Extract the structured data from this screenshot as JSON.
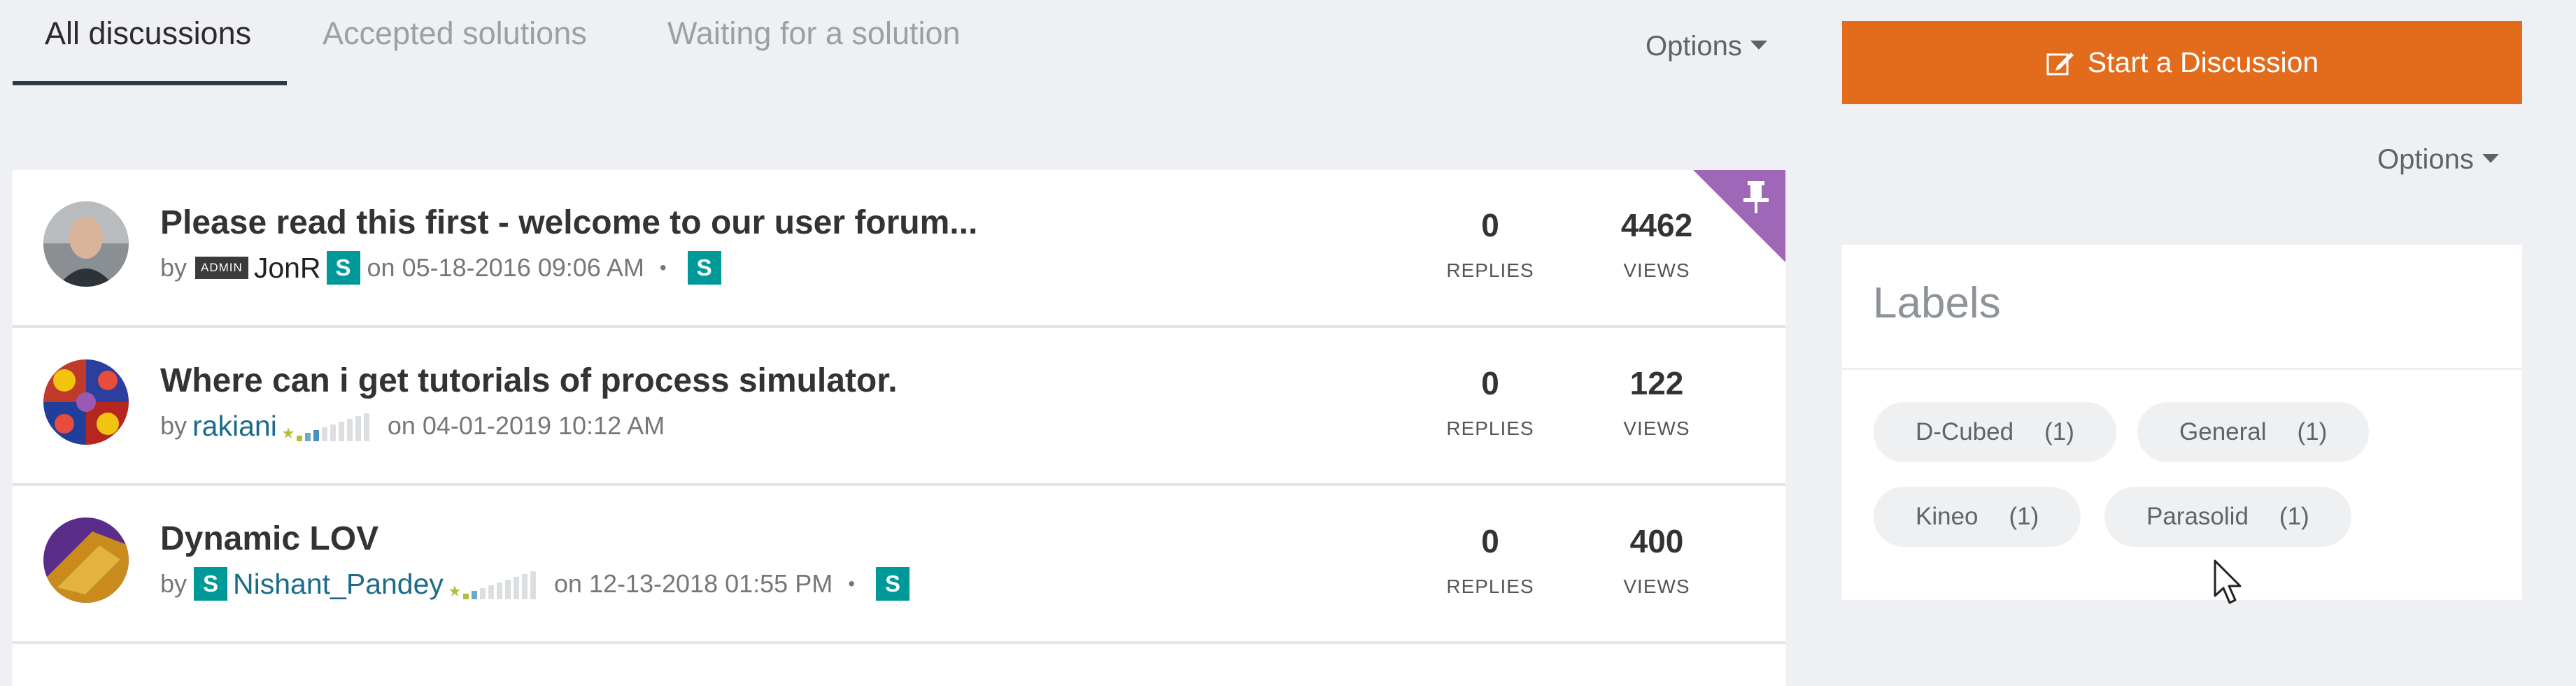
{
  "tabs": [
    {
      "label": "All discussions",
      "active": true
    },
    {
      "label": "Accepted solutions",
      "active": false
    },
    {
      "label": "Waiting for a solution",
      "active": false
    }
  ],
  "options_label": "Options",
  "start_button": {
    "label": "Start a Discussion",
    "icon": "edit-icon",
    "color": "#e36b1c"
  },
  "sidebar_options_label": "Options",
  "labels_panel": {
    "title": "Labels",
    "items": [
      {
        "name": "D-Cubed",
        "count": "(1)"
      },
      {
        "name": "General",
        "count": "(1)"
      },
      {
        "name": "Kineo",
        "count": "(1)"
      },
      {
        "name": "Parasolid",
        "count": "(1)"
      }
    ]
  },
  "discussions": [
    {
      "title": "Please read this first - welcome to our user forum...",
      "by": "by",
      "admin_badge": "ADMIN",
      "author": "JonR",
      "date": "on 05-18-2016 09:06 AM",
      "replies": "0",
      "replies_label": "REPLIES",
      "views": "4462",
      "views_label": "VIEWS",
      "pinned": true
    },
    {
      "title": "Where can i get tutorials of process simulator.",
      "by": "by",
      "author": "rakiani",
      "date": "on 04-01-2019 10:12 AM",
      "replies": "0",
      "replies_label": "REPLIES",
      "views": "122",
      "views_label": "VIEWS",
      "pinned": false
    },
    {
      "title": "Dynamic LOV",
      "by": "by",
      "author": "Nishant_Pandey",
      "date": "on 12-13-2018 01:55 PM",
      "replies": "0",
      "replies_label": "REPLIES",
      "views": "400",
      "views_label": "VIEWS",
      "pinned": false
    }
  ],
  "badge_letter": "S",
  "colors": {
    "accent": "#e36b1c",
    "badge": "#009999",
    "pin": "#9f67b7",
    "link": "#1a6b8a"
  }
}
